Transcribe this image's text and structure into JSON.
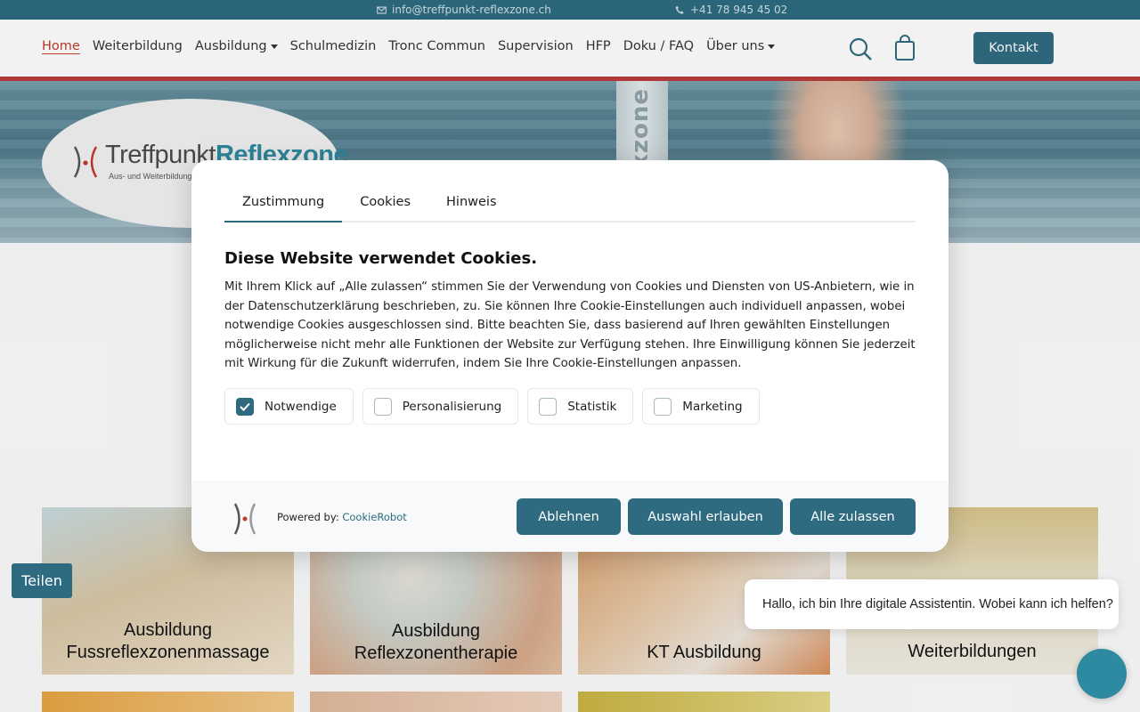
{
  "topbar": {
    "email": "info@treffpunkt-reflexzone.ch",
    "phone": "+41 78 945 45 02"
  },
  "nav": {
    "items": [
      {
        "label": "Home",
        "active": true,
        "dropdown": false
      },
      {
        "label": "Weiterbildung",
        "active": false,
        "dropdown": false
      },
      {
        "label": "Ausbildung",
        "active": false,
        "dropdown": true
      },
      {
        "label": "Schulmedizin",
        "active": false,
        "dropdown": false
      },
      {
        "label": "Tronc Commun",
        "active": false,
        "dropdown": false
      },
      {
        "label": "Supervision",
        "active": false,
        "dropdown": false
      },
      {
        "label": "HFP",
        "active": false,
        "dropdown": false
      },
      {
        "label": "Doku / FAQ",
        "active": false,
        "dropdown": false
      },
      {
        "label": "Über uns",
        "active": false,
        "dropdown": true
      }
    ],
    "contact_label": "Kontakt"
  },
  "hero": {
    "logo_word1": "Treffpunkt",
    "logo_word2": "Reflexzone",
    "logo_sub": "Aus- und Weiterbildung",
    "pillar_text": "reflexzone"
  },
  "cards": [
    {
      "line1": "Ausbildung",
      "line2": "Fussreflexzonenmassage"
    },
    {
      "line1": "Ausbildung",
      "line2": "Reflexzonentherapie"
    },
    {
      "line1": "",
      "line2": "KT Ausbildung"
    },
    {
      "line1": "",
      "line2": "Weiterbildungen"
    }
  ],
  "share_label": "Teilen",
  "chat": {
    "message": "Hallo, ich bin Ihre digitale Assistentin. Wobei kann ich helfen?"
  },
  "cookie": {
    "tabs": [
      "Zustimmung",
      "Cookies",
      "Hinweis"
    ],
    "active_tab": "Zustimmung",
    "title": "Diese Website verwendet Cookies.",
    "body": "Mit Ihrem Klick auf „Alle zulassen“ stimmen Sie der Verwendung von Cookies und Diensten von US-Anbietern, wie in der Datenschutzerklärung beschrieben, zu. Sie können Ihre Cookie-Einstellungen auch individuell anpassen, wobei notwendige Cookies ausgeschlossen sind. Bitte beachten Sie, dass basierend auf Ihren gewählten Einstellungen möglicherweise nicht mehr alle Funktionen der Website zur Verfügung stehen. Ihre Einwilligung können Sie jederzeit mit Wirkung für die Zukunft widerrufen, indem Sie Ihre Cookie-Einstellungen anpassen.",
    "options": [
      {
        "label": "Notwendige",
        "checked": true
      },
      {
        "label": "Personalisierung",
        "checked": false
      },
      {
        "label": "Statistik",
        "checked": false
      },
      {
        "label": "Marketing",
        "checked": false
      }
    ],
    "powered_by": "Powered by:",
    "powered_brand": "CookieRobot",
    "buttons": {
      "decline": "Ablehnen",
      "allow_selection": "Auswahl erlauben",
      "allow_all": "Alle zulassen"
    }
  },
  "colors": {
    "primary": "#2e6b80",
    "accent_red": "#b83a3a",
    "topbar": "#2c6a80"
  }
}
